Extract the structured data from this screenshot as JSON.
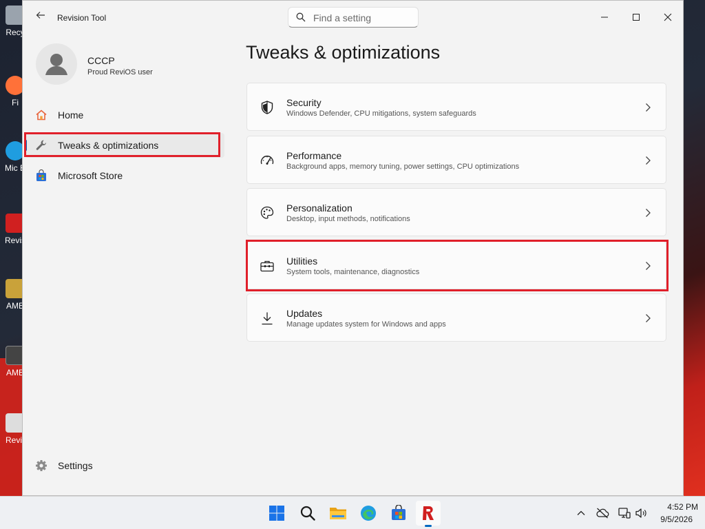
{
  "window": {
    "title": "Revision Tool",
    "search_placeholder": "Find a setting"
  },
  "profile": {
    "name": "CCCP",
    "subtitle": "Proud ReviOS user"
  },
  "sidebar": {
    "items": [
      {
        "label": "Home",
        "icon": "home-icon"
      },
      {
        "label": "Tweaks & optimizations",
        "icon": "wrench-icon",
        "active": true
      },
      {
        "label": "Microsoft Store",
        "icon": "store-icon"
      }
    ],
    "settings_label": "Settings"
  },
  "main": {
    "title": "Tweaks & optimizations",
    "cards": [
      {
        "title": "Security",
        "desc": "Windows Defender, CPU mitigations, system safeguards",
        "icon": "shield-icon"
      },
      {
        "title": "Performance",
        "desc": "Background apps, memory tuning, power settings, CPU optimizations",
        "icon": "speedometer-icon"
      },
      {
        "title": "Personalization",
        "desc": "Desktop, input methods, notifications",
        "icon": "palette-icon"
      },
      {
        "title": "Utilities",
        "desc": "System tools, maintenance, diagnostics",
        "icon": "toolbox-icon"
      },
      {
        "title": "Updates",
        "desc": "Manage updates system for Windows and apps",
        "icon": "download-icon"
      }
    ]
  },
  "desktop_icons": [
    {
      "label": "Recy"
    },
    {
      "label": "Fi"
    },
    {
      "label": "Mic E"
    },
    {
      "label": "Revis"
    },
    {
      "label": "AME"
    },
    {
      "label": "AME"
    },
    {
      "label": "Revi-"
    }
  ],
  "taskbar": {
    "time": "4:52 PM",
    "date": "9/5/2026"
  },
  "colors": {
    "accent": "#0067c0",
    "highlight": "#e01f2a",
    "window_bg": "#f3f3f3",
    "card_bg": "#fbfbfb"
  }
}
